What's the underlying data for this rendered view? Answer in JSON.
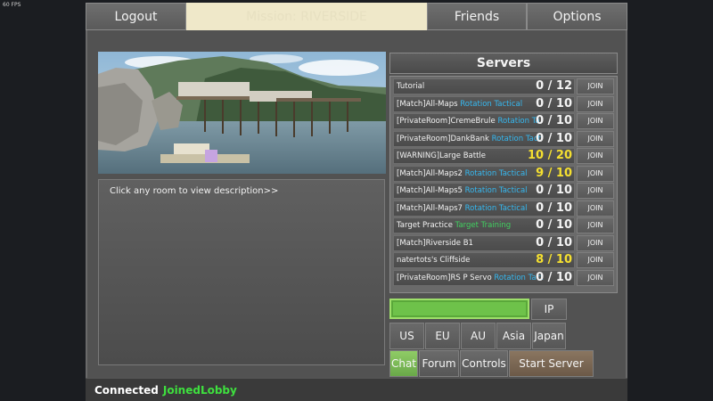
{
  "fps": "60 FPS",
  "nav": {
    "logout": "Logout",
    "mission": "Mission: RIVERSIDE",
    "friends": "Friends",
    "options": "Options"
  },
  "description": {
    "hint": "Click any room to view description>>"
  },
  "servers": {
    "title": "Servers",
    "join_label": "JOIN",
    "rows": [
      {
        "name": "Tutorial",
        "tag": "",
        "players": "0 / 12",
        "highlight": false
      },
      {
        "name": "[Match]All-Maps ",
        "tag": "Rotation Tactical",
        "players": "0 / 10",
        "highlight": false
      },
      {
        "name": "[PrivateRoom]CremeBrule ",
        "tag": "Rotation Ta",
        "players": "0 / 10",
        "highlight": false
      },
      {
        "name": "[PrivateRoom]DankBank ",
        "tag": "Rotation Tacti",
        "players": "0 / 10",
        "highlight": false
      },
      {
        "name": "[WARNING]Large Battle",
        "tag": "",
        "players": "10 / 20",
        "highlight": true
      },
      {
        "name": "[Match]All-Maps2 ",
        "tag": "Rotation Tactical",
        "players": "9 / 10",
        "highlight": true
      },
      {
        "name": "[Match]All-Maps5 ",
        "tag": "Rotation Tactical",
        "players": "0 / 10",
        "highlight": false
      },
      {
        "name": "[Match]All-Maps7 ",
        "tag": "Rotation Tactical",
        "players": "0 / 10",
        "highlight": false
      },
      {
        "name": "Target Practice ",
        "tag": "Target Training",
        "players": "0 / 10",
        "highlight": false
      },
      {
        "name": "[Match]Riverside B1",
        "tag": "",
        "players": "0 / 10",
        "highlight": false
      },
      {
        "name": "natertots's Cliffside",
        "tag": "",
        "players": "8 / 10",
        "highlight": true
      },
      {
        "name": "[PrivateRoom]RS P Servo ",
        "tag": "Rotation Tact",
        "players": "0 / 10",
        "highlight": false
      }
    ]
  },
  "controls": {
    "ip_value": "",
    "ip_button": "IP",
    "regions": [
      "US",
      "EU",
      "AU",
      "Asia",
      "Japan"
    ],
    "chat": "Chat",
    "forum": "Forum",
    "controls": "Controls",
    "start_server": "Start Server"
  },
  "status": {
    "connected": "Connected",
    "state": "JoinedLobby"
  },
  "colors": {
    "title_bar": "#efe8c9",
    "tag_blue": "#35b8f0",
    "tag_green": "#40d060",
    "warn_yellow": "#f5e030",
    "input_green": "#6ec24a",
    "status_green": "#3ee03e"
  }
}
